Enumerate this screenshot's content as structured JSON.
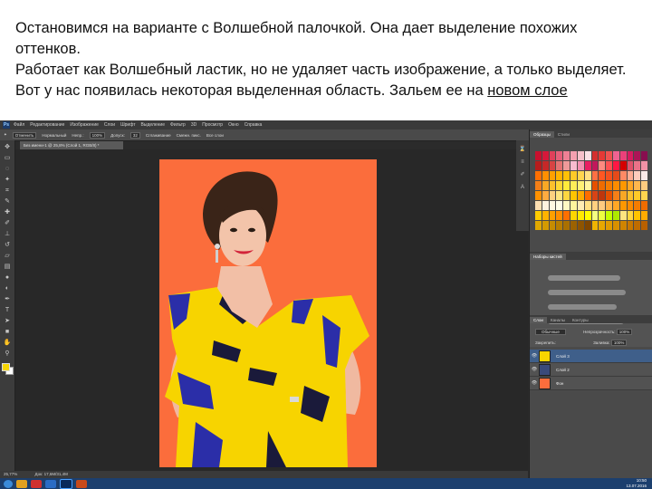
{
  "caption": {
    "line1": "Остановимся на варианте с Волшебной палочкой. Она дает выделение похожих оттенков.",
    "line2": "Работает как Волшебный ластик, но не удаляет часть изображение, а только выделяет.",
    "line3_prefix": "Вот у нас появилась некоторая выделенная область. Зальем ее на ",
    "line3_link": "новом слое"
  },
  "app": {
    "menu": [
      "Файл",
      "Редактирование",
      "Изображение",
      "Слои",
      "Шрифт",
      "Выделение",
      "Фильтр",
      "3D",
      "Просмотр",
      "Окно",
      "Справка"
    ],
    "options": {
      "label1": "Отменить",
      "mode_label": "Нормальный",
      "opacity_label": "Непр.:",
      "opacity_value": "100%",
      "tolerance_label": "Допуск:",
      "tolerance_value": "32",
      "antialias": "Сглаживание",
      "contiguous": "Смежн. пикс.",
      "all_layers": "Все слои"
    },
    "doc_tab": "Без имени-1 @ 25,8% (Слой 1, RGB/8) *",
    "status": {
      "zoom": "25,77%",
      "doc": "Док: 17,6M/31,4M"
    },
    "panel_tabs": [
      "Образцы",
      "Стили"
    ],
    "brush_tabs": [
      "Наборы кистей"
    ],
    "layers_tabs": [
      "Слои",
      "Каналы",
      "Контуры"
    ],
    "blend_mode": "Обычные",
    "layers_opacity_label": "Непрозрачность:",
    "layers_opacity": "100%",
    "fill_label": "Заливка:",
    "fill_value": "100%",
    "lock_label": "Закрепить:",
    "layers": [
      {
        "name": "Слой 3",
        "selected": true
      },
      {
        "name": "Слой 2",
        "selected": false
      },
      {
        "name": "Фон",
        "selected": false
      }
    ],
    "colors": {
      "canvas_bg": "#fb6d3c",
      "fg": "#f5d400",
      "selection": "#3f5f8a"
    },
    "clock": {
      "time": "10:50",
      "date": "13.07.2016"
    }
  }
}
